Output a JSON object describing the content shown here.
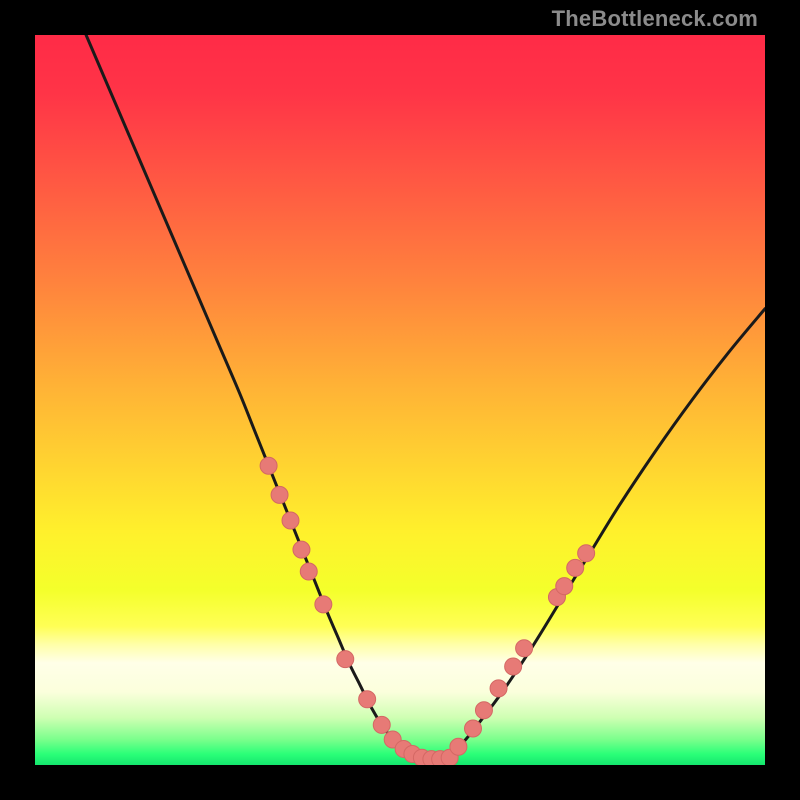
{
  "watermark": "TheBottleneck.com",
  "colors": {
    "frame": "#000000",
    "watermark": "#8b8b8b",
    "curve": "#1a1a1a",
    "marker_fill": "#e77a76",
    "marker_stroke": "#d46864",
    "gradient_stops": [
      {
        "offset": 0.0,
        "color": "#ff2b47"
      },
      {
        "offset": 0.08,
        "color": "#ff3447"
      },
      {
        "offset": 0.2,
        "color": "#ff5843"
      },
      {
        "offset": 0.34,
        "color": "#ff833d"
      },
      {
        "offset": 0.48,
        "color": "#ffb236"
      },
      {
        "offset": 0.58,
        "color": "#ffd131"
      },
      {
        "offset": 0.68,
        "color": "#fff02c"
      },
      {
        "offset": 0.76,
        "color": "#f4ff2b"
      },
      {
        "offset": 0.81,
        "color": "#ffff55"
      },
      {
        "offset": 0.835,
        "color": "#ffffa8"
      },
      {
        "offset": 0.86,
        "color": "#ffffe8"
      },
      {
        "offset": 0.9,
        "color": "#fbffdc"
      },
      {
        "offset": 0.935,
        "color": "#cfffb3"
      },
      {
        "offset": 0.965,
        "color": "#7bff8c"
      },
      {
        "offset": 0.985,
        "color": "#2bff78"
      },
      {
        "offset": 1.0,
        "color": "#14e66e"
      }
    ]
  },
  "chart_data": {
    "type": "line",
    "title": "",
    "xlabel": "",
    "ylabel": "",
    "xlim": [
      0,
      100
    ],
    "ylim": [
      0,
      100
    ],
    "grid": false,
    "legend": false,
    "series": [
      {
        "name": "bottleneck-curve",
        "x": [
          7,
          10,
          13,
          16,
          19,
          22,
          25,
          28,
          30,
          32,
          34,
          36,
          38,
          40,
          41.5,
          43,
          44.5,
          46,
          47.5,
          49,
          50.5,
          52,
          53.5,
          55,
          57,
          59,
          61,
          64,
          68,
          72,
          76,
          80,
          85,
          90,
          95,
          100
        ],
        "y": [
          100,
          93,
          86,
          79,
          72,
          65,
          58,
          51,
          46,
          41,
          36,
          31,
          26,
          21,
          17.5,
          14,
          11,
          8,
          5.5,
          3.5,
          2,
          1,
          0.5,
          0.5,
          1.5,
          3.5,
          6,
          10,
          16,
          22.5,
          29,
          35.5,
          43,
          50,
          56.5,
          62.5
        ]
      }
    ],
    "markers": [
      {
        "x": 32.0,
        "y": 41.0
      },
      {
        "x": 33.5,
        "y": 37.0
      },
      {
        "x": 35.0,
        "y": 33.5
      },
      {
        "x": 36.5,
        "y": 29.5
      },
      {
        "x": 37.5,
        "y": 26.5
      },
      {
        "x": 39.5,
        "y": 22.0
      },
      {
        "x": 42.5,
        "y": 14.5
      },
      {
        "x": 45.5,
        "y": 9.0
      },
      {
        "x": 47.5,
        "y": 5.5
      },
      {
        "x": 49.0,
        "y": 3.5
      },
      {
        "x": 50.5,
        "y": 2.2
      },
      {
        "x": 51.7,
        "y": 1.5
      },
      {
        "x": 53.0,
        "y": 1.0
      },
      {
        "x": 54.3,
        "y": 0.8
      },
      {
        "x": 55.5,
        "y": 0.8
      },
      {
        "x": 56.8,
        "y": 1.0
      },
      {
        "x": 58.0,
        "y": 2.5
      },
      {
        "x": 60.0,
        "y": 5.0
      },
      {
        "x": 61.5,
        "y": 7.5
      },
      {
        "x": 63.5,
        "y": 10.5
      },
      {
        "x": 65.5,
        "y": 13.5
      },
      {
        "x": 67.0,
        "y": 16.0
      },
      {
        "x": 71.5,
        "y": 23.0
      },
      {
        "x": 72.5,
        "y": 24.5
      },
      {
        "x": 74.0,
        "y": 27.0
      },
      {
        "x": 75.5,
        "y": 29.0
      }
    ],
    "marker_radius_px": 8.5
  }
}
